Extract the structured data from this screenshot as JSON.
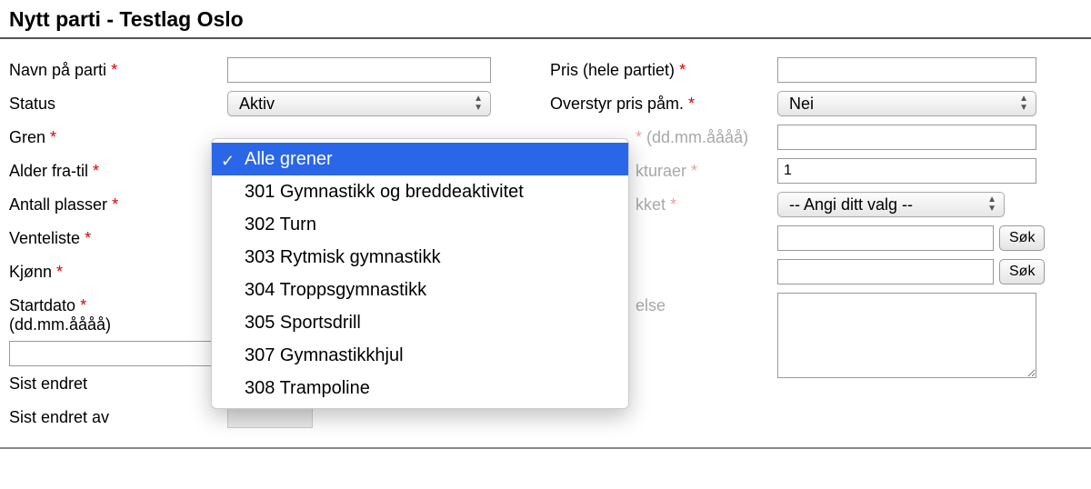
{
  "header": {
    "title": "Nytt parti - Testlag Oslo"
  },
  "left": {
    "navn_label": "Navn på parti",
    "navn_value": "",
    "status_label": "Status",
    "status_value": "Aktiv",
    "gren_label": "Gren",
    "alder_label": "Alder fra-til",
    "plasser_label": "Antall plasser",
    "venteliste_label": "Venteliste",
    "kjonn_label": "Kjønn",
    "startdato_label": "Startdato",
    "datofmt": "(dd.mm.åååå)",
    "sist_endret_label": "Sist endret",
    "sist_endret_av_label": "Sist endret av"
  },
  "right": {
    "pris_label": "Pris (hele partiet)",
    "pris_value": "",
    "overstyr_label": "Overstyr pris påm.",
    "overstyr_value": "Nei",
    "sluttdato_hidden_tail": "(dd.mm.åååå)",
    "fakturaer_tail": "kturaer",
    "fakturaer_value": "1",
    "aapent_tail": "kket",
    "aapent_value": "-- Angi ditt valg --",
    "hovedtrener_tail": "",
    "hjelpetrener_tail": "",
    "beskrivelse_tail": "else",
    "sok": "Søk"
  },
  "dropdown": {
    "items": [
      {
        "label": "Alle grener",
        "selected": true
      },
      {
        "label": "301 Gymnastikk og breddeaktivitet",
        "selected": false
      },
      {
        "label": "302 Turn",
        "selected": false
      },
      {
        "label": "303 Rytmisk gymnastikk",
        "selected": false
      },
      {
        "label": "304 Troppsgymnastikk",
        "selected": false
      },
      {
        "label": "305 Sportsdrill",
        "selected": false
      },
      {
        "label": "307 Gymnastikkhjul",
        "selected": false
      },
      {
        "label": "308 Trampoline",
        "selected": false
      }
    ]
  }
}
